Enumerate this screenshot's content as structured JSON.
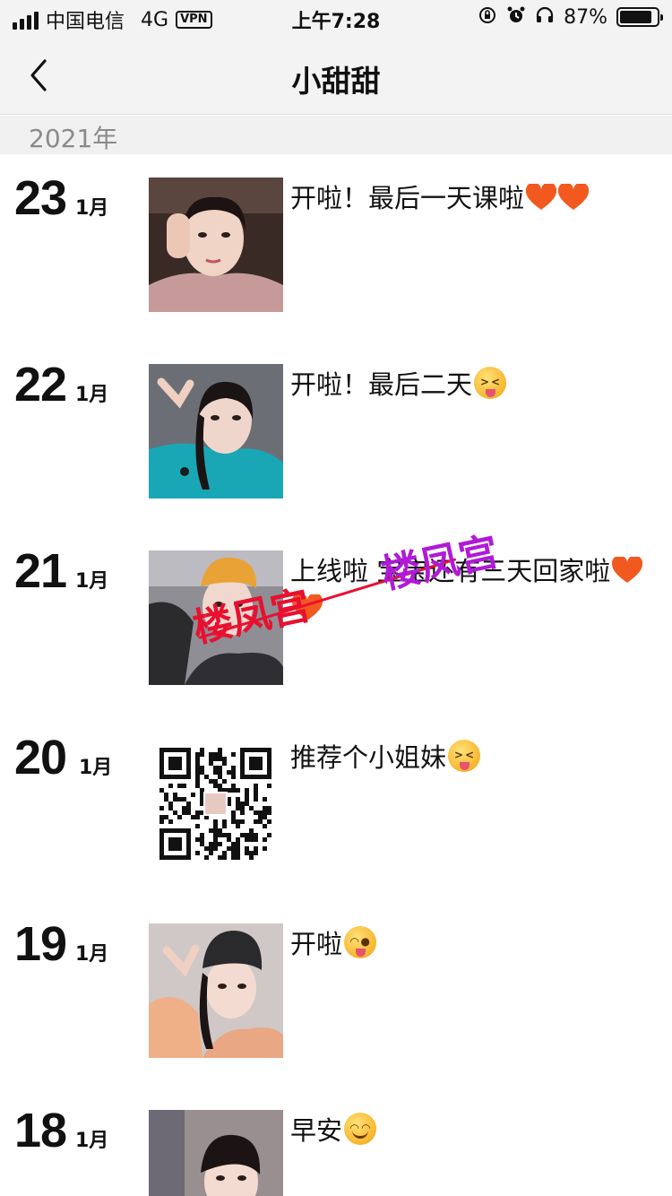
{
  "status_bar": {
    "carrier": "中国电信",
    "network": "4G",
    "vpn": "VPN",
    "time": "上午7:28",
    "battery_percent": "87%",
    "battery_level": 0.87,
    "icons": [
      "orientation-lock-icon",
      "alarm-icon",
      "headphones-icon",
      "battery-icon"
    ]
  },
  "nav": {
    "title": "小甜甜",
    "back_icon": "chevron-left-icon"
  },
  "year_label": "2021年",
  "posts": [
    {
      "day": "23",
      "month": "1月",
      "text": "开啦！最后一天课啦",
      "emoji": [
        "heart",
        "heart"
      ]
    },
    {
      "day": "22",
      "month": "1月",
      "text": "开啦！最后二天",
      "emoji": [
        "squint-tongue"
      ]
    },
    {
      "day": "21",
      "month": "1月",
      "text": "上线啦 宝宝还有三天回家啦",
      "emoji": [
        "heart",
        "heart"
      ]
    },
    {
      "day": "20",
      "month": "1月",
      "text": "推荐个小姐妹",
      "emoji": [
        "squint-tongue"
      ]
    },
    {
      "day": "19",
      "month": "1月",
      "text": "开啦",
      "emoji": [
        "wink-tongue"
      ]
    },
    {
      "day": "18",
      "month": "1月",
      "text": "早安",
      "emoji": [
        "smile"
      ]
    }
  ],
  "watermark": {
    "text_red": "楼凤宫",
    "text_purple": "楼凤宫"
  },
  "colors": {
    "bar_bg": "#f3f3f3",
    "heart": "#f2591f",
    "watermark_red": "#e8102f",
    "watermark_purple": "#b01ad6"
  }
}
